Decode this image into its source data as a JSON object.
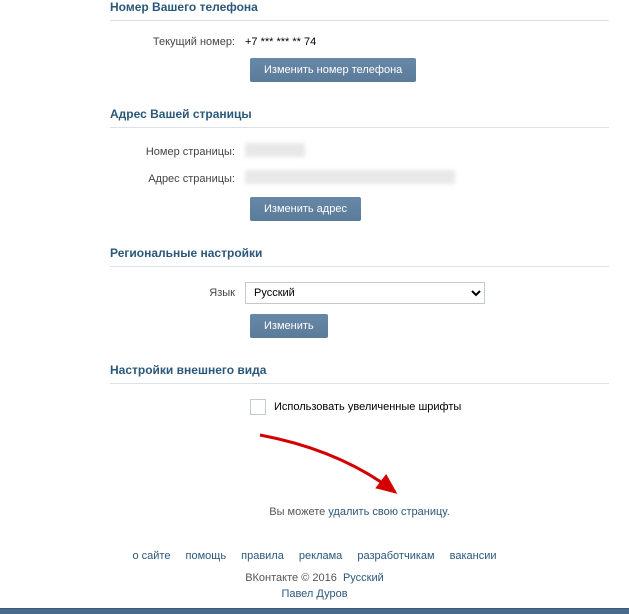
{
  "phone": {
    "header": "Номер Вашего телефона",
    "current_label": "Текущий номер:",
    "current_value": "+7 *** *** ** 74",
    "change_button": "Изменить номер телефона"
  },
  "address": {
    "header": "Адрес Вашей страницы",
    "page_number_label": "Номер страницы:",
    "page_address_label": "Адрес страницы:",
    "change_button": "Изменить адрес"
  },
  "regional": {
    "header": "Региональные настройки",
    "language_label": "Язык",
    "language_value": "Русский",
    "change_button": "Изменить"
  },
  "appearance": {
    "header": "Настройки внешнего вида",
    "large_fonts_label": "Использовать увеличенные шрифты"
  },
  "delete": {
    "prefix": "Вы можете ",
    "link": "удалить свою страницу",
    "suffix": "."
  },
  "footer": {
    "links": {
      "about": "о сайте",
      "help": "помощь",
      "rules": "правила",
      "ads": "реклама",
      "developers": "разработчикам",
      "jobs": "вакансии"
    },
    "copyright_brand": "ВКонтакте",
    "copyright_symbol": "©",
    "copyright_year": "2016",
    "language_link": "Русский",
    "author": "Павел Дуров"
  }
}
